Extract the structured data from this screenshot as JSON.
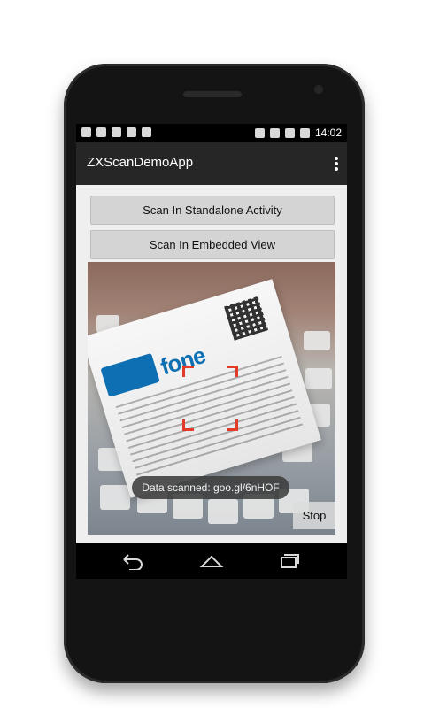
{
  "status_bar": {
    "time": "14:02"
  },
  "action_bar": {
    "title": "ZXScanDemoApp"
  },
  "buttons": {
    "standalone": "Scan In Standalone Activity",
    "embedded": "Scan In Embedded View"
  },
  "scanner": {
    "toast": "Data scanned: goo.gl/6nHOF",
    "stop_label": "Stop"
  },
  "card": {
    "brand": "fone"
  },
  "nav_icons": [
    "back-icon",
    "home-icon",
    "recent-apps-icon"
  ],
  "colors": {
    "scan_bracket": "#e23b2a",
    "brand_blue": "#0f6fb3"
  }
}
